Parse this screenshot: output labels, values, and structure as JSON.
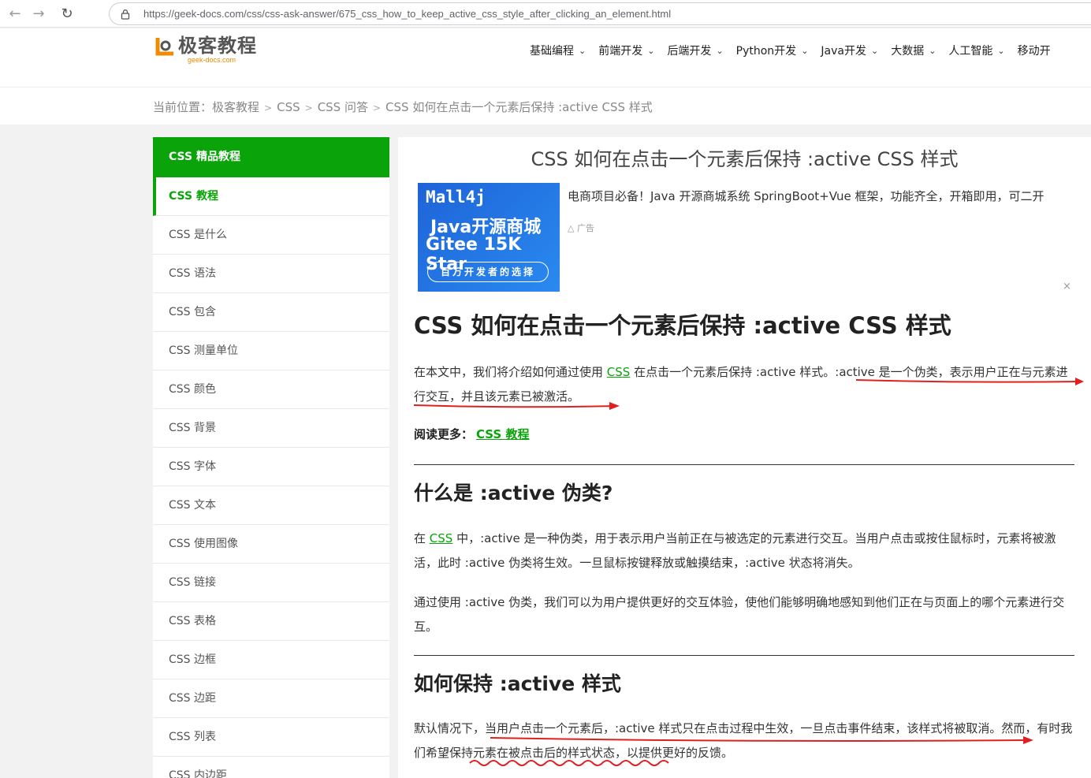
{
  "browser": {
    "url": "https://geek-docs.com/css/css-ask-answer/675_css_how_to_keep_active_css_style_after_clicking_an_element.html"
  },
  "site": {
    "logo_cn": "极客教程",
    "logo_en": "geek-docs.com",
    "nav": [
      "基础编程",
      "前端开发",
      "后端开发",
      "Python开发",
      "Java开发",
      "大数据",
      "人工智能",
      "移动开"
    ]
  },
  "breadcrumb": {
    "prefix": "当前位置：",
    "items": [
      "极客教程",
      "CSS",
      "CSS 问答",
      "CSS 如何在点击一个元素后保持 :active CSS 样式"
    ],
    "sep": ">"
  },
  "sidebar": {
    "heading": "CSS 精品教程",
    "items": [
      "CSS 教程",
      "CSS 是什么",
      "CSS 语法",
      "CSS 包含",
      "CSS 测量单位",
      "CSS 颜色",
      "CSS 背景",
      "CSS 字体",
      "CSS 文本",
      "CSS 使用图像",
      "CSS 链接",
      "CSS 表格",
      "CSS 边框",
      "CSS 边距",
      "CSS 列表",
      "CSS 内边距"
    ],
    "active_index": 0
  },
  "article": {
    "title": "CSS 如何在点击一个元素后保持 :active CSS 样式",
    "ad": {
      "line1": "Mall4j",
      "line2": "Java开源商城",
      "line3": "Gitee 15K Star",
      "pill": "百万开发者的选择",
      "text": "电商项目必备！Java 开源商城系统 SpringBoot+Vue 框架，功能齐全，开箱即用，可二开",
      "badge": "广告",
      "close": "×"
    },
    "h1": "CSS 如何在点击一个元素后保持 :active CSS 样式",
    "intro_a": "在本文中，我们将介绍如何通过使用 ",
    "intro_link": "CSS",
    "intro_b": " 在点击一个元素后保持 :active 样式。:active 是一个伪类，表示用户正在与元素进行交互，并且该元素已被激活。",
    "readmore_label": "阅读更多：",
    "readmore_link": "CSS 教程",
    "h2_1": "什么是 :active 伪类?",
    "p1_a": "在 ",
    "p1_link": "CSS",
    "p1_b": " 中，:active 是一种伪类，用于表示用户当前正在与被选定的元素进行交互。当用户点击或按住鼠标时，元素将被激活，此时 :active 伪类将生效。一旦鼠标按键释放或触摸结束，:active 状态将消失。",
    "p2": "通过使用 :active 伪类，我们可以为用户提供更好的交互体验，使他们能够明确地感知到他们正在与页面上的哪个元素进行交互。",
    "h2_2": "如何保持 :active 样式",
    "p3": "默认情况下，当用户点击一个元素后，:active 样式只在点击过程中生效，一旦点击事件结束，该样式将被取消。然而，有时我们希望保持元素在被点击后的样式状态，以提供更好的反馈。"
  },
  "colors": {
    "brand_green": "#0aa30a",
    "annotation_red": "#e02020"
  }
}
